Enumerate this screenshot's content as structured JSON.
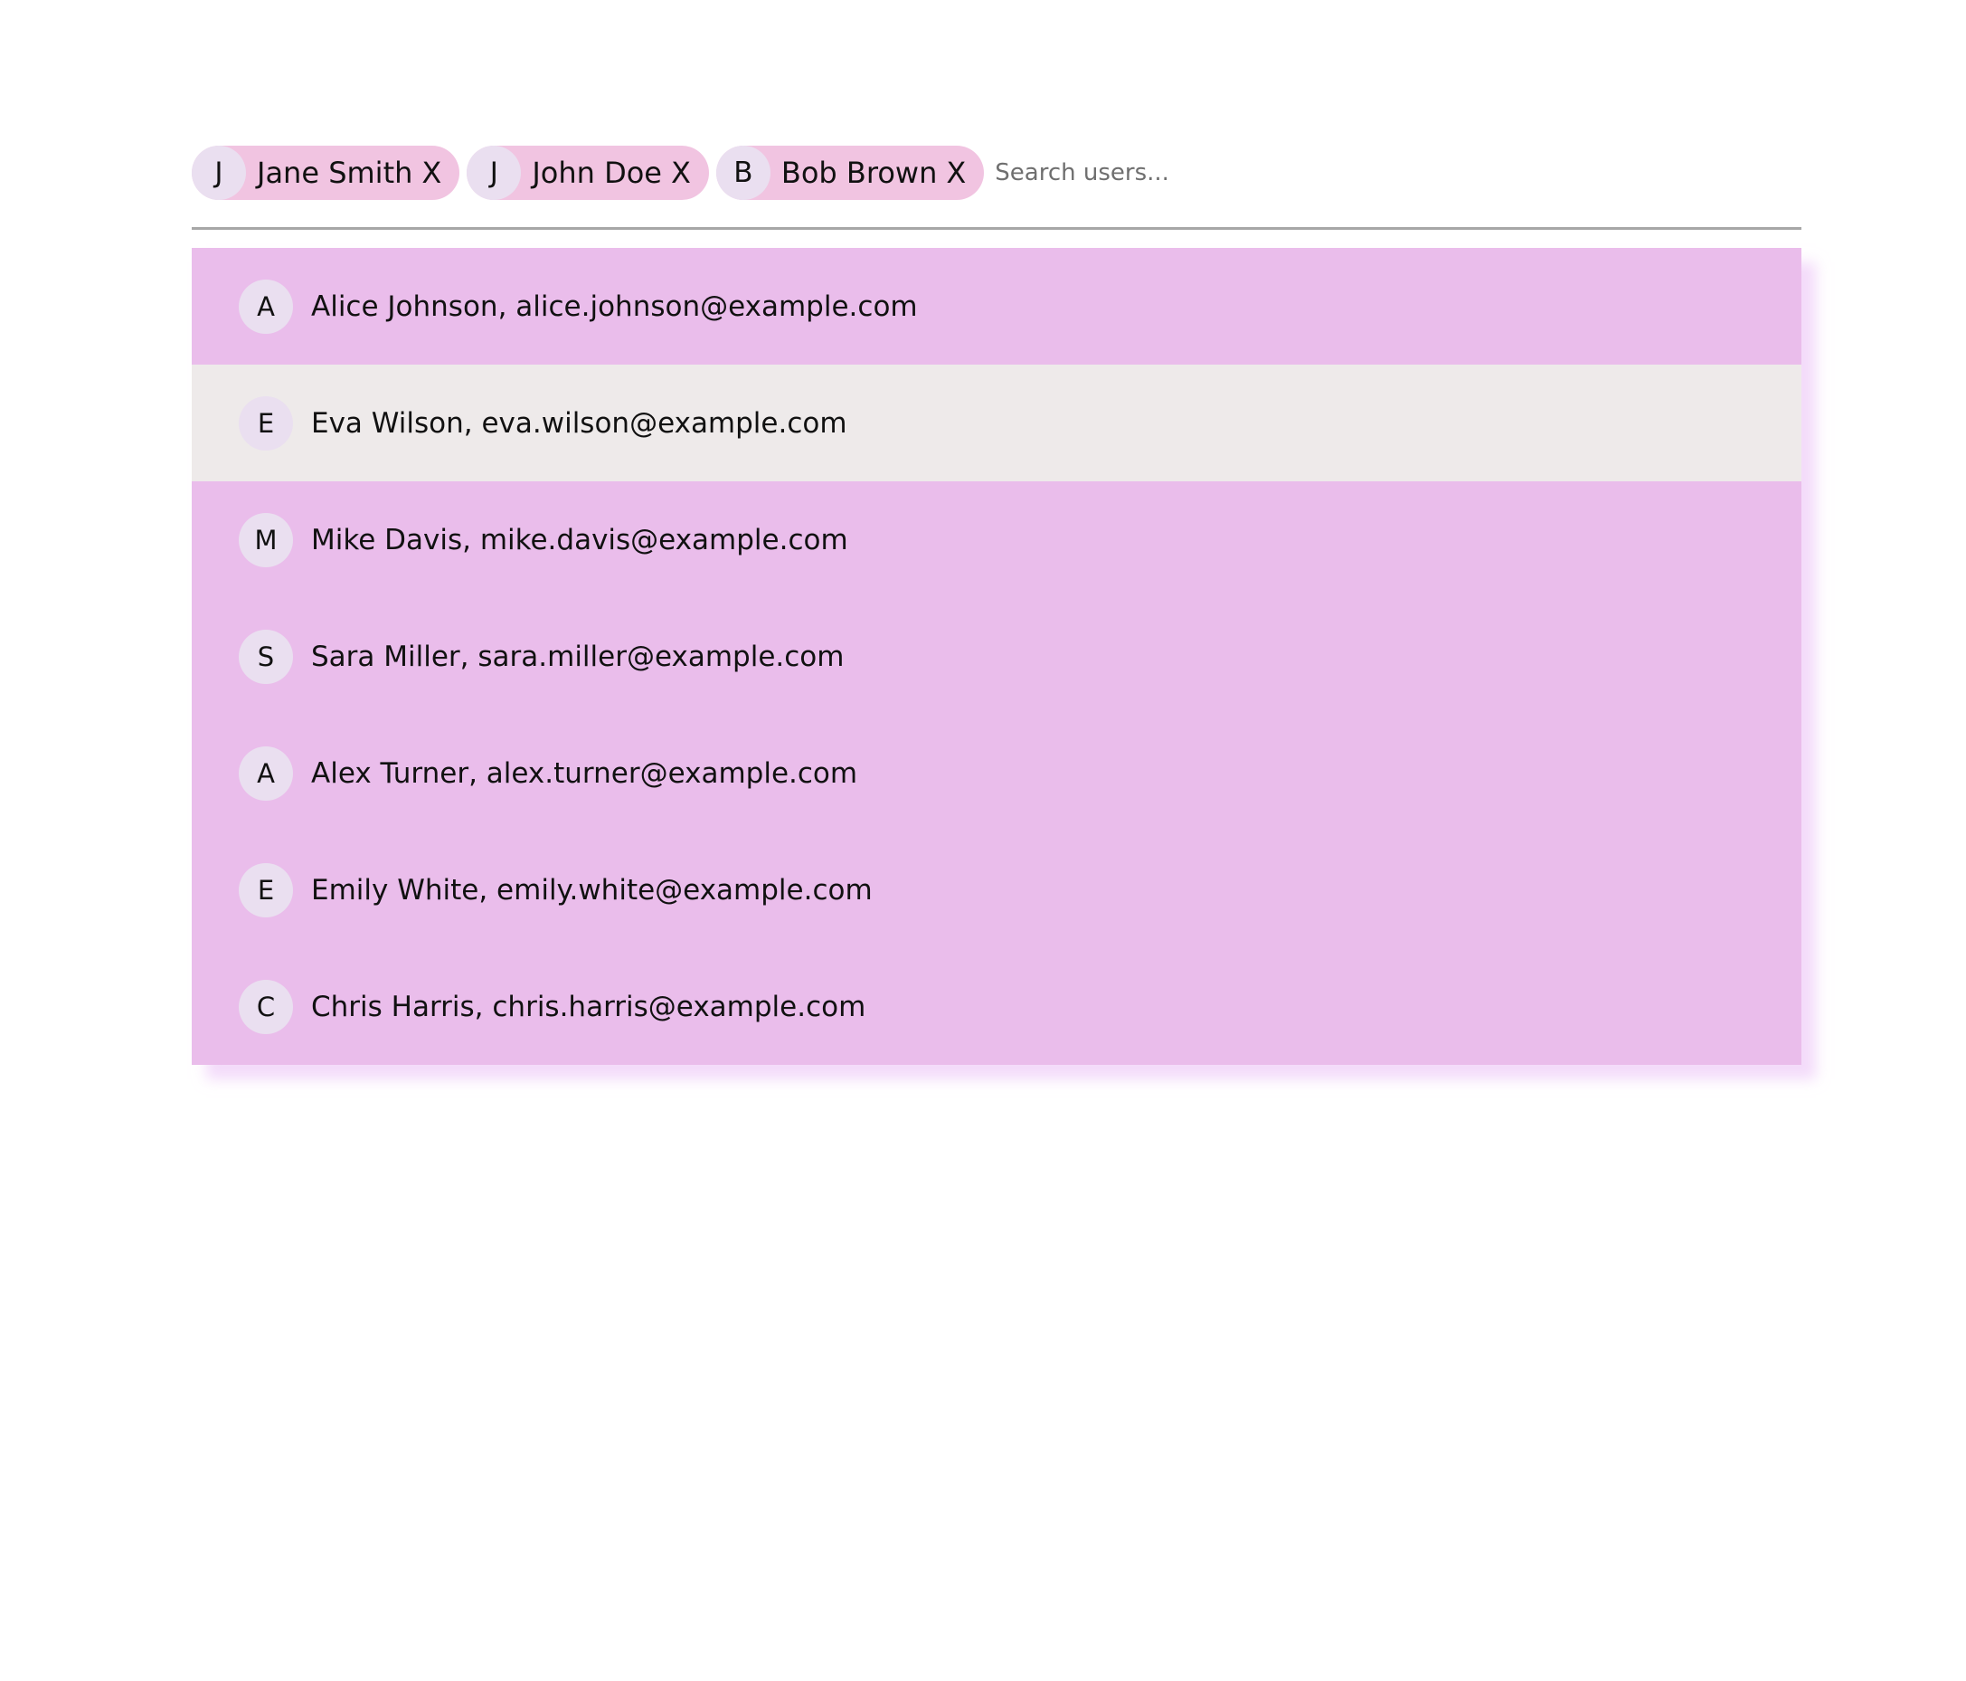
{
  "selected_users": [
    {
      "initial": "J",
      "name": "Jane Smith",
      "remove_label": "X"
    },
    {
      "initial": "J",
      "name": "John Doe",
      "remove_label": "X"
    },
    {
      "initial": "B",
      "name": "Bob Brown",
      "remove_label": "X"
    }
  ],
  "search": {
    "placeholder": "Search users...",
    "value": ""
  },
  "options": [
    {
      "initial": "A",
      "label": "Alice Johnson, alice.johnson@example.com"
    },
    {
      "initial": "E",
      "label": "Eva Wilson, eva.wilson@example.com"
    },
    {
      "initial": "M",
      "label": "Mike Davis, mike.davis@example.com"
    },
    {
      "initial": "S",
      "label": "Sara Miller, sara.miller@example.com"
    },
    {
      "initial": "A",
      "label": "Alex Turner, alex.turner@example.com"
    },
    {
      "initial": "E",
      "label": "Emily White, emily.white@example.com"
    },
    {
      "initial": "C",
      "label": "Chris Harris, chris.harris@example.com"
    }
  ],
  "highlighted_option_index": 1,
  "colors": {
    "chip_background": "#f1c4e1",
    "avatar_background": "#eadff0",
    "dropdown_background": "#eabdeb",
    "highlighted_row": "#eeeaea",
    "divider": "#a7a7a7"
  }
}
